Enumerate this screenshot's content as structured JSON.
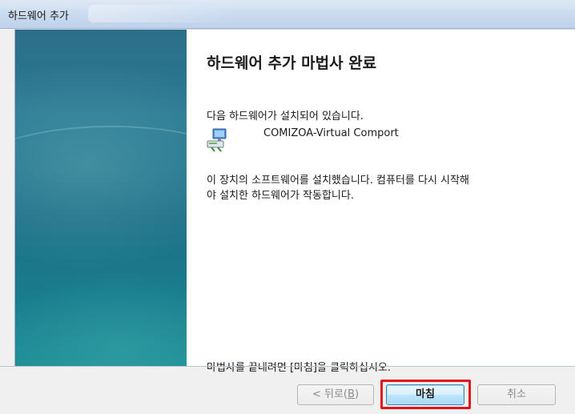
{
  "window": {
    "title": "하드웨어 추가"
  },
  "wizard": {
    "heading": "하드웨어 추가 마법사 완료",
    "installed_intro": "다음 하드웨어가 설치되어 있습니다.",
    "device_name": "COMIZOA-Virtual Comport",
    "device_icon": "network-device-icon",
    "restart_line1": "이 장치의 소프트웨어를 설치했습니다. 컴퓨터를 다시 시작해",
    "restart_line2": "야 설치한 하드웨어가 작동합니다.",
    "finish_hint": "마법사를 끝내려면 [마침]을 클릭하십시오."
  },
  "buttons": {
    "back_label_prefix": "< 뒤로(",
    "back_accel": "B",
    "back_label_suffix": ")",
    "back_enabled": false,
    "finish_label": "마침",
    "cancel_label": "취소",
    "cancel_enabled": false
  },
  "colors": {
    "highlight": "#e0161c",
    "left_pane": "#1f6f86"
  }
}
